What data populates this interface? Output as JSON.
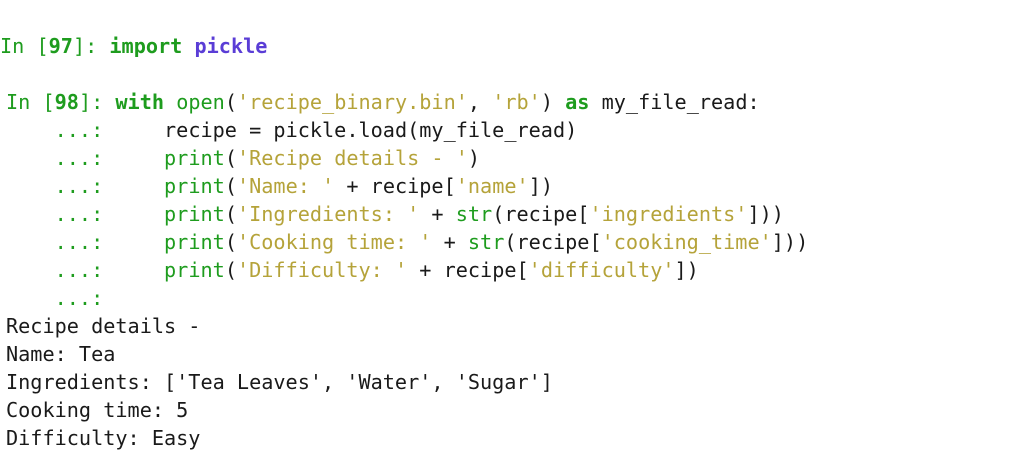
{
  "cells": [
    {
      "prompt_open": "In [",
      "number": "97",
      "prompt_close": "]: ",
      "code": {
        "kw_import": "import",
        "module": "pickle"
      }
    },
    {
      "prompt_open": "In [",
      "number": "98",
      "prompt_close": "]: ",
      "continuation": "...:",
      "lines": {
        "l1": {
          "with": "with",
          "open": "open",
          "p1": "(",
          "file": "'recipe_binary.bin'",
          "comma": ", ",
          "mode": "'rb'",
          "p2": ")",
          "as": "as",
          "var": " my_file_read:"
        },
        "l2": {
          "text": "recipe = pickle.load(my_file_read)"
        },
        "l3": {
          "print": "print",
          "open": "(",
          "s1": "'Recipe details - '",
          "close": ")"
        },
        "l4": {
          "print": "print",
          "open": "(",
          "s1": "'Name: '",
          "mid": " + recipe[",
          "s2": "'name'",
          "close": "])"
        },
        "l5": {
          "print": "print",
          "open": "(",
          "s1": "'Ingredients: '",
          "plus": " + ",
          "fn": "str",
          "mid": "(recipe[",
          "s2": "'ingredients'",
          "close": "]))"
        },
        "l6": {
          "print": "print",
          "open": "(",
          "s1": "'Cooking time: '",
          "plus": " + ",
          "fn": "str",
          "mid": "(recipe[",
          "s2": "'cooking_time'",
          "close": "]))"
        },
        "l7": {
          "print": "print",
          "open": "(",
          "s1": "'Difficulty: '",
          "mid": " + recipe[",
          "s2": "'difficulty'",
          "close": "])"
        }
      }
    }
  ],
  "output": [
    "Recipe details -",
    "Name: Tea",
    "Ingredients: ['Tea Leaves', 'Water', 'Sugar']",
    "Cooking time: 5",
    "Difficulty: Easy"
  ]
}
